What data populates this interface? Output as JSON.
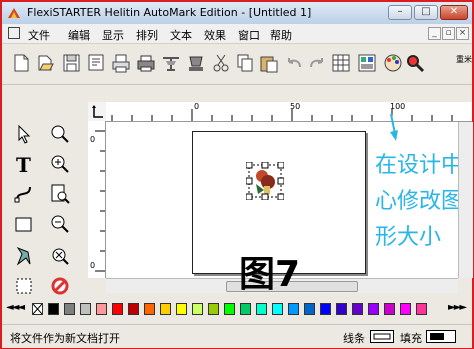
{
  "window": {
    "title": "FlexiSTARTER Helitin AutoMark Edition - [Untitled 1]",
    "controls": {
      "minimize": "–",
      "maximize": "□",
      "close": "✕"
    }
  },
  "menubar": {
    "items": [
      "文件",
      "编辑",
      "显示",
      "排列",
      "文本",
      "效果",
      "窗口",
      "帮助"
    ],
    "mdi_controls": [
      "_",
      "▫",
      "×"
    ]
  },
  "toolbar": {
    "buttons": [
      "new-document-icon",
      "open-icon",
      "save-icon",
      "print-preview-icon",
      "print-icon",
      "printer-icon",
      "cut-plot-icon",
      "rip-icon",
      "scissors-icon",
      "copy-icon",
      "paste-icon",
      "undo-icon",
      "redo-icon",
      "grid-view-icon",
      "color-view-icon",
      "color-palette-icon",
      "zoom-icon"
    ],
    "overflow_label": "重米"
  },
  "tools": [
    "select-arrow-icon",
    "zoom-in-icon",
    "text-tool-icon",
    "zoom-plus-icon",
    "path-edit-icon",
    "zoom-page-icon",
    "rectangle-tool-icon",
    "zoom-minus-icon",
    "warp-tool-icon",
    "zoom-pan-icon",
    "color-fill-icon",
    "no-entry-icon"
  ],
  "ruler": {
    "h_labels": [
      "0",
      "50",
      "100"
    ],
    "v_labels": [
      "0",
      "0"
    ]
  },
  "palette": {
    "nav_left": "◄◄◄",
    "nav_right": "►►►",
    "colors": [
      "#ffffff",
      "#000000",
      "#7f7f7f",
      "#c0c0c0",
      "#ff9999",
      "#ff0000",
      "#c00000",
      "#ff6600",
      "#ffcc00",
      "#ffff00",
      "#ccff66",
      "#99cc00",
      "#00ff00",
      "#00cc66",
      "#00ffcc",
      "#00ffff",
      "#0099ff",
      "#0066cc",
      "#0000ff",
      "#3300cc",
      "#6600cc",
      "#9900ff",
      "#cc00cc",
      "#ff00ff",
      "#ff3399"
    ]
  },
  "status": {
    "left_text": "将文件作为新文档打开",
    "stroke_label": "线条",
    "fill_label": "填充"
  },
  "annotations": {
    "lines": [
      "在设计中",
      "心修改图",
      "形大小"
    ],
    "figure_label": "图7"
  },
  "colors": {
    "annotation": "#29b6e6",
    "frame": "#d81e1e"
  }
}
